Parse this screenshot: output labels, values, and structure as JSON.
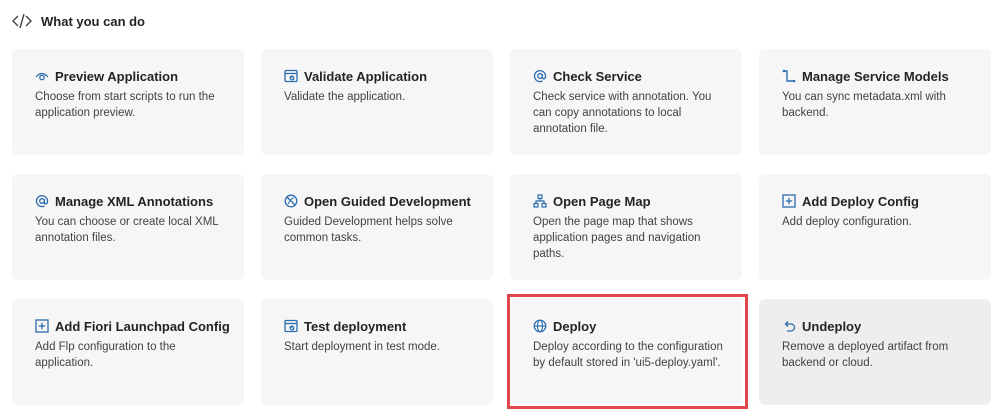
{
  "header": {
    "title": "What you can do",
    "icon": "code-icon"
  },
  "cards": [
    {
      "title": "Preview Application",
      "icon": "eye-icon",
      "description": "Choose from start scripts to run the application preview."
    },
    {
      "title": "Validate Application",
      "icon": "validate-icon",
      "description": "Validate the application."
    },
    {
      "title": "Check Service",
      "icon": "at-icon",
      "description": "Check service with annotation. You can copy annotations to local annotation file."
    },
    {
      "title": "Manage Service Models",
      "icon": "service-model-icon",
      "description": "You can sync metadata.xml with backend."
    },
    {
      "title": "Manage XML Annotations",
      "icon": "at-icon",
      "description": "You can choose or create local XML annotation files."
    },
    {
      "title": "Open Guided Development",
      "icon": "guided-development-icon",
      "description": "Guided Development helps solve common tasks."
    },
    {
      "title": "Open Page Map",
      "icon": "page-map-icon",
      "description": "Open the page map that shows application pages and navigation paths."
    },
    {
      "title": "Add Deploy Config",
      "icon": "plus-box-icon",
      "description": "Add deploy configuration."
    },
    {
      "title": "Add Fiori Launchpad Config",
      "icon": "plus-box-icon",
      "description": "Add Flp configuration to the application."
    },
    {
      "title": "Test deployment",
      "icon": "validate-icon",
      "description": "Start deployment in test mode."
    },
    {
      "title": "Deploy",
      "icon": "globe-icon",
      "description": "Deploy according to the configuration by default stored in 'ui5-deploy.yaml'."
    },
    {
      "title": "Undeploy",
      "icon": "undo-icon",
      "description": "Remove a deployed artifact from backend or cloud."
    }
  ],
  "colors": {
    "card_bg": "#f6f6f6",
    "icon": "#2b6cb0",
    "highlight": "#e0474c"
  }
}
